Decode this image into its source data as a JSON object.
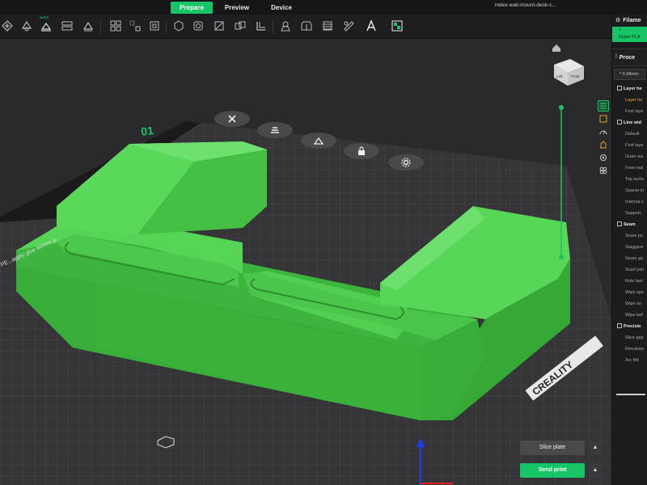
{
  "tabs": [
    {
      "label": "Prepare",
      "active": true
    },
    {
      "label": "Preview",
      "active": false
    },
    {
      "label": "Device",
      "active": false
    }
  ],
  "file_title": "index-wall-mount-desk-c...",
  "toolbar": {
    "auto_label": "AUTO",
    "icons": [
      "add-icon",
      "orient-icon",
      "auto-orient-icon",
      "arrange-icon",
      "layout-icon",
      "split-icon",
      "grid-icon",
      "move-icon",
      "rotate-icon",
      "scale-icon",
      "cut-icon",
      "mirror-icon",
      "support-paint-icon",
      "seam-paint-icon",
      "color-paint-icon",
      "measure-icon",
      "assemble-icon",
      "text-icon",
      "variable-layer-icon"
    ]
  },
  "plate": {
    "number": "01",
    "brand": "CREALITY",
    "edge_text": "PE...apply glue before p..."
  },
  "view_cube": {
    "left": "Left",
    "front": "Front"
  },
  "panel": {
    "filament_header": "Filame",
    "filament_index": "1",
    "filament_name": "Hyper PLA",
    "process_header": "Proce",
    "preset": "* 0.08mm",
    "settings": [
      {
        "label": "Layer he",
        "type": "group"
      },
      {
        "label": "Layer he",
        "type": "highlight"
      },
      {
        "label": "First laye",
        "type": "item"
      },
      {
        "label": "Line wid",
        "type": "group"
      },
      {
        "label": "Default",
        "type": "item"
      },
      {
        "label": "First laye",
        "type": "item"
      },
      {
        "label": "Outer wa",
        "type": "item"
      },
      {
        "label": "Inner wal",
        "type": "item"
      },
      {
        "label": "Top surfa",
        "type": "item"
      },
      {
        "label": "Sparse in",
        "type": "item"
      },
      {
        "label": "Internal s",
        "type": "item"
      },
      {
        "label": "Support",
        "type": "item"
      },
      {
        "label": "Seam",
        "type": "group"
      },
      {
        "label": "Seam po",
        "type": "item"
      },
      {
        "label": "Staggere",
        "type": "item"
      },
      {
        "label": "Seam ga",
        "type": "item"
      },
      {
        "label": "Scarf join",
        "type": "item"
      },
      {
        "label": "Role bas",
        "type": "item"
      },
      {
        "label": "Wipe spe",
        "type": "item"
      },
      {
        "label": "Wipe on",
        "type": "item"
      },
      {
        "label": "Wipe bef",
        "type": "item"
      },
      {
        "label": "Precisio",
        "type": "group"
      },
      {
        "label": "Slice gap",
        "type": "item"
      },
      {
        "label": "Resolutio",
        "type": "item"
      },
      {
        "label": "Arc fitti",
        "type": "item"
      }
    ]
  },
  "buttons": {
    "slice": "Slice plate",
    "send": "Send print",
    "caret": "▲"
  },
  "colors": {
    "accent": "#17c566",
    "model": "#3fbf3f",
    "plate": "#38383b"
  }
}
